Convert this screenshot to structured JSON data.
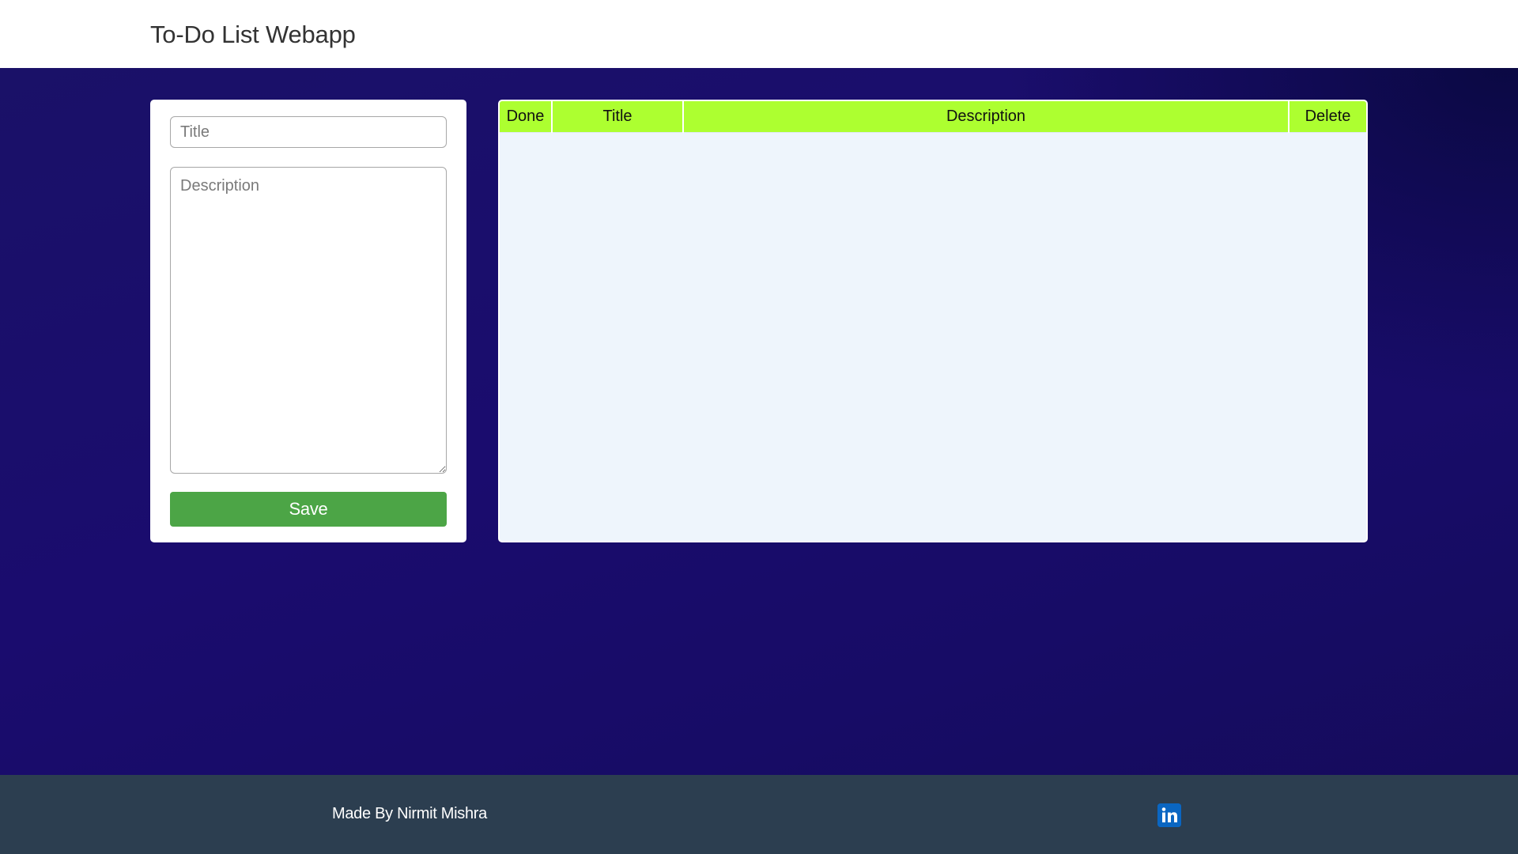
{
  "header": {
    "app_title": "To-Do List Webapp"
  },
  "form": {
    "title_placeholder": "Title",
    "description_placeholder": "Description",
    "save_label": "Save"
  },
  "table": {
    "columns": [
      "Done",
      "Title",
      "Description",
      "Delete"
    ],
    "rows": [],
    "header_color": "#adff30"
  },
  "footer": {
    "credit": "Made By Nirmit Mishra",
    "social_icon": "linkedin-icon"
  },
  "colors": {
    "accent_green": "#4ca546",
    "background_navy": "#1a0c6e",
    "footer_bg": "#2c3e50",
    "linkedin_blue": "#0a66c2"
  }
}
